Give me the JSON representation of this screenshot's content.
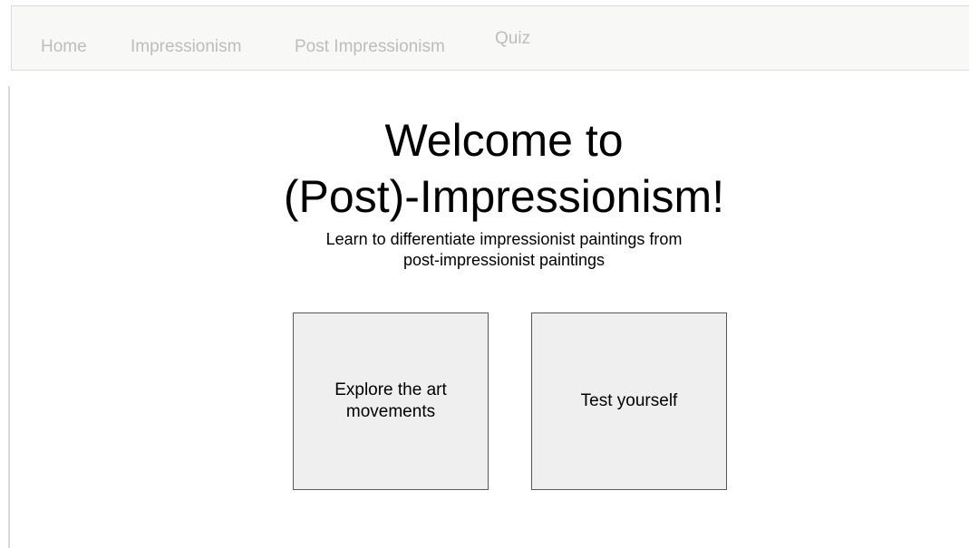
{
  "nav": {
    "items": [
      {
        "label": "Home"
      },
      {
        "label": "Impressionism"
      },
      {
        "label": "Post Impressionism"
      },
      {
        "label": "Quiz"
      }
    ]
  },
  "hero": {
    "title_line1": "Welcome to",
    "title_line2": "(Post)-Impressionism!",
    "subtitle_line1": "Learn to differentiate impressionist paintings from",
    "subtitle_line2": "post-impressionist paintings"
  },
  "cards": {
    "explore_label": "Explore the art movements",
    "test_label": "Test yourself"
  },
  "colors": {
    "navbar_bg": "#f8f8f7",
    "nav_text": "#bdbdbd",
    "card_bg": "#efefef",
    "card_border": "#595959"
  }
}
